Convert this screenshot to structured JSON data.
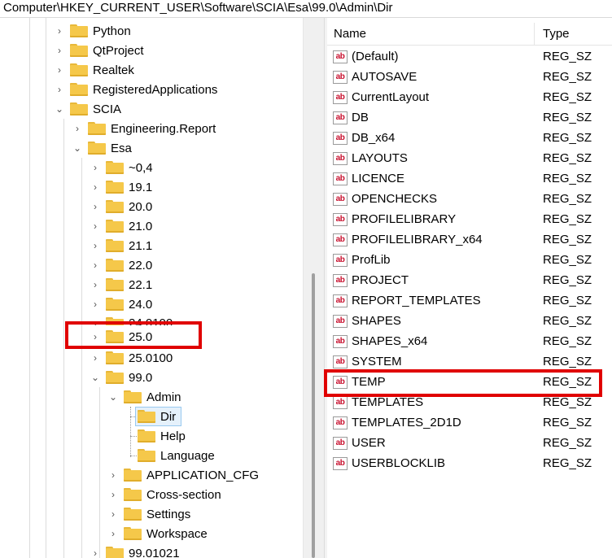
{
  "address_bar": {
    "path": "Computer\\HKEY_CURRENT_USER\\Software\\SCIA\\Esa\\99.0\\Admin\\Dir"
  },
  "tree": {
    "python": "Python",
    "qtproject": "QtProject",
    "realtek": "Realtek",
    "registered_applications": "RegisteredApplications",
    "scia": "SCIA",
    "engineering_report": "Engineering.Report",
    "esa": "Esa",
    "v0_4": "~0,4",
    "v19_1": "19.1",
    "v20_0": "20.0",
    "v21_0": "21.0",
    "v21_1": "21.1",
    "v22_0": "22.0",
    "v22_1": "22.1",
    "v24_0": "24.0",
    "v24_0100": "24.0100",
    "v25_0": "25.0",
    "v25_0100": "25.0100",
    "v99_0": "99.0",
    "admin": "Admin",
    "dir": "Dir",
    "help": "Help",
    "language": "Language",
    "application_cfg": "APPLICATION_CFG",
    "cross_section": "Cross-section",
    "settings": "Settings",
    "workspace": "Workspace",
    "v99_01021": "99.01021"
  },
  "values_list": {
    "col_name": "Name",
    "col_type": "Type",
    "rows": [
      {
        "name": "(Default)",
        "type": "REG_SZ"
      },
      {
        "name": "AUTOSAVE",
        "type": "REG_SZ"
      },
      {
        "name": "CurrentLayout",
        "type": "REG_SZ"
      },
      {
        "name": "DB",
        "type": "REG_SZ"
      },
      {
        "name": "DB_x64",
        "type": "REG_SZ"
      },
      {
        "name": "LAYOUTS",
        "type": "REG_SZ"
      },
      {
        "name": "LICENCE",
        "type": "REG_SZ"
      },
      {
        "name": "OPENCHECKS",
        "type": "REG_SZ"
      },
      {
        "name": "PROFILELIBRARY",
        "type": "REG_SZ"
      },
      {
        "name": "PROFILELIBRARY_x64",
        "type": "REG_SZ"
      },
      {
        "name": "ProfLib",
        "type": "REG_SZ"
      },
      {
        "name": "PROJECT",
        "type": "REG_SZ"
      },
      {
        "name": "REPORT_TEMPLATES",
        "type": "REG_SZ"
      },
      {
        "name": "SHAPES",
        "type": "REG_SZ"
      },
      {
        "name": "SHAPES_x64",
        "type": "REG_SZ"
      },
      {
        "name": "SYSTEM",
        "type": "REG_SZ"
      },
      {
        "name": "TEMP",
        "type": "REG_SZ"
      },
      {
        "name": "TEMPLATES",
        "type": "REG_SZ"
      },
      {
        "name": "TEMPLATES_2D1D",
        "type": "REG_SZ"
      },
      {
        "name": "USER",
        "type": "REG_SZ"
      },
      {
        "name": "USERBLOCKLIB",
        "type": "REG_SZ"
      }
    ],
    "value_icon": "ab"
  },
  "highlight_color": "#e00000"
}
